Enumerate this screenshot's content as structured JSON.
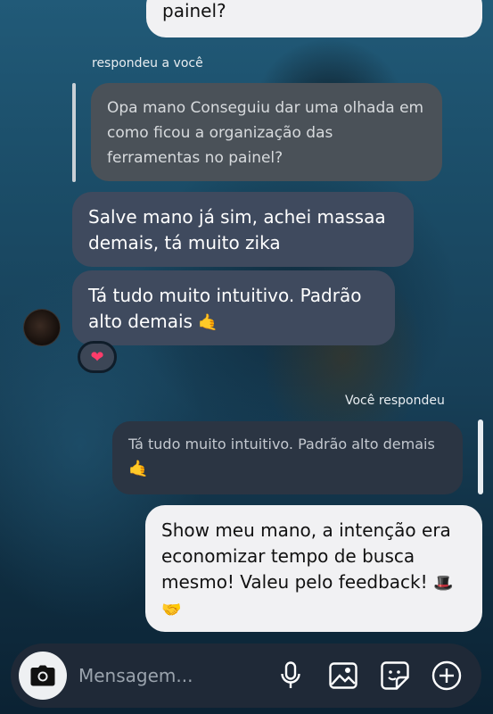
{
  "chat": {
    "top_message_tail": "painel?",
    "reply_in_label": "respondeu a você",
    "reply_in_quote": "Opa mano Conseguiu dar uma olhada em como ficou a organização das ferramentas no painel?",
    "incoming_1": "Salve mano já sim, achei massaa demais, tá muito zika",
    "incoming_2_text": "Tá tudo muito intuitivo. Padrão alto demais",
    "incoming_2_emoji": "🤙",
    "reaction": "❤",
    "reply_out_label": "Você respondeu",
    "reply_out_quote_text": "Tá tudo muito intuitivo. Padrão alto demais",
    "reply_out_quote_emoji": "🤙",
    "outgoing_text": "Show meu mano, a intenção era economizar tempo de busca mesmo! Valeu pelo feedback!",
    "outgoing_emoji_1": "🎩",
    "outgoing_emoji_2": "🤝"
  },
  "composer": {
    "placeholder": "Mensagem...",
    "icons": [
      "camera-icon",
      "microphone-icon",
      "gallery-icon",
      "sticker-icon",
      "add-icon"
    ]
  },
  "colors": {
    "outgoing_bubble": "#f1f1f3",
    "incoming_bubble": "#3f4a5e",
    "composer": "#1f2937"
  }
}
